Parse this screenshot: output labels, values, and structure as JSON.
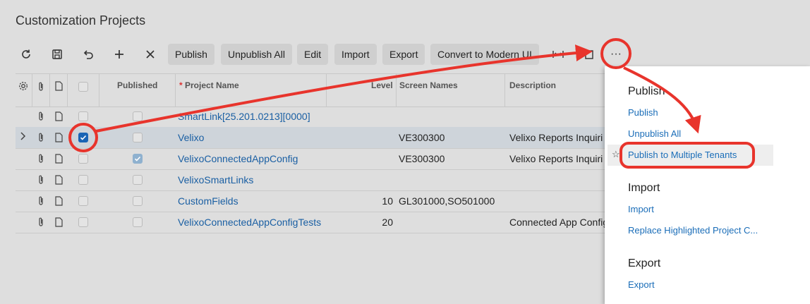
{
  "page_title": "Customization Projects",
  "toolbar": {
    "buttons": [
      "Publish",
      "Unpublish All",
      "Edit",
      "Import",
      "Export",
      "Convert to Modern UI"
    ]
  },
  "grid": {
    "headers": {
      "published": "Published",
      "required_mark": "*",
      "project_name": "Project Name",
      "level": "Level",
      "screen_names": "Screen Names",
      "description": "Description"
    },
    "rows": [
      {
        "name": "SmartLink[25.201.0213][0000]",
        "level": "",
        "screens": "",
        "description": "",
        "selected": false,
        "published": false
      },
      {
        "name": "Velixo",
        "level": "",
        "screens": "VE300300",
        "description": "Velixo Reports Inquiri",
        "selected": true,
        "published": false
      },
      {
        "name": "VelixoConnectedAppConfig",
        "level": "",
        "screens": "VE300300",
        "description": "Velixo Reports Inquiri",
        "selected": false,
        "published": true
      },
      {
        "name": "VelixoSmartLinks",
        "level": "",
        "screens": "",
        "description": "",
        "selected": false,
        "published": false
      },
      {
        "name": "CustomFields",
        "level": "10",
        "screens": "GL301000,SO501000",
        "description": "",
        "selected": false,
        "published": false
      },
      {
        "name": "VelixoConnectedAppConfigTests",
        "level": "20",
        "screens": "",
        "description": "Connected App Config",
        "selected": false,
        "published": false
      }
    ]
  },
  "menu": {
    "more_label": "···",
    "sections": [
      {
        "heading": "Publish",
        "items": [
          "Publish",
          "Unpublish All",
          "Publish to Multiple Tenants"
        ]
      },
      {
        "heading": "Import",
        "items": [
          "Import",
          "Replace Highlighted Project C..."
        ]
      },
      {
        "heading": "Export",
        "items": [
          "Export"
        ]
      }
    ]
  },
  "colors": {
    "annotation": "#e8342c",
    "link": "#1a5fa3",
    "selected_row": "#ced4da",
    "checkbox_on": "#1a64b5"
  }
}
